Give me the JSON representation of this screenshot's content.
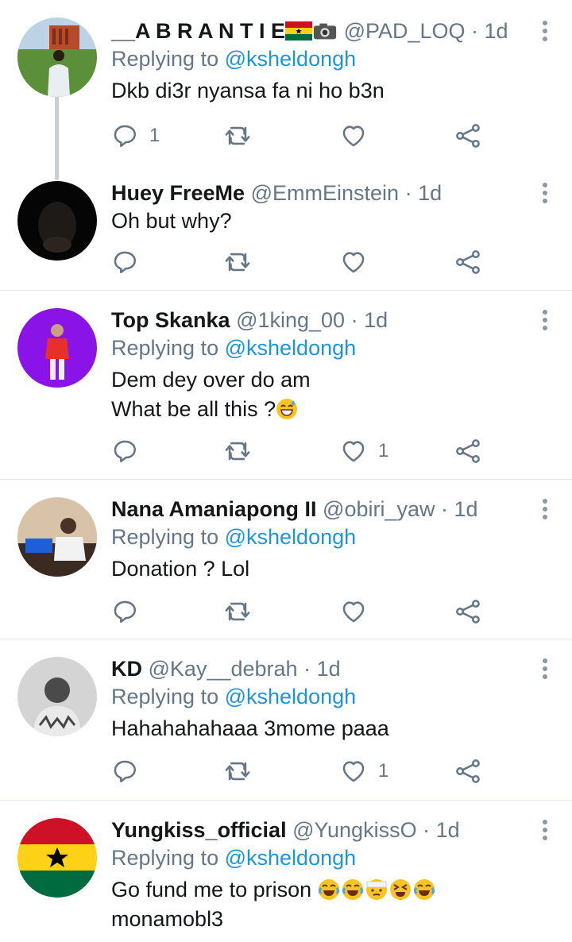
{
  "tweets": [
    {
      "name": "__A B R A N T I E",
      "name_badges": [
        "ghana-flag",
        "camera-icon"
      ],
      "handle": "@PAD_LOQ",
      "time": "1d",
      "reply_prefix": "Replying to",
      "reply_to": "@ksheldongh",
      "text": [
        "Dkb di3r nyansa fa ni ho b3n"
      ],
      "reply_count": "1",
      "like_count": ""
    },
    {
      "name": "Huey FreeMe",
      "handle": "@EmmEinstein",
      "time": "1d",
      "text": [
        "Oh but why?"
      ],
      "reply_count": "",
      "like_count": ""
    },
    {
      "name": "Top Skanka",
      "handle": "@1king_00",
      "time": "1d",
      "reply_prefix": "Replying to",
      "reply_to": "@ksheldongh",
      "text": [
        "Dem dey over do am",
        "What be all this ?"
      ],
      "text_emoji": [
        "",
        "grinning-sweat-emoji"
      ],
      "reply_count": "",
      "like_count": "1"
    },
    {
      "name": "Nana Amaniapong II",
      "handle": "@obiri_yaw",
      "time": "1d",
      "reply_prefix": "Replying to",
      "reply_to": "@ksheldongh",
      "text": [
        "Donation ? Lol"
      ],
      "reply_count": "",
      "like_count": ""
    },
    {
      "name": "KD",
      "handle": "@Kay__debrah",
      "time": "1d",
      "reply_prefix": "Replying to",
      "reply_to": "@ksheldongh",
      "text": [
        "Hahahahahaaa 3mome paaa"
      ],
      "reply_count": "",
      "like_count": "1"
    },
    {
      "name": "Yungkiss_official",
      "handle": "@YungkissO",
      "time": "1d",
      "reply_prefix": "Replying to",
      "reply_to": "@ksheldongh",
      "text": [
        "Go fund me to prison ",
        "monamobl3"
      ],
      "text_emoji": [
        "joy-emoji joy-emoji bandage-emoji tired-emoji joy-emoji",
        ""
      ],
      "reply_count": "",
      "like_count": ""
    }
  ],
  "colors": {
    "link": "#1b95e0",
    "muted": "#657786",
    "text": "#14171a",
    "divider": "#e1e8ed"
  }
}
